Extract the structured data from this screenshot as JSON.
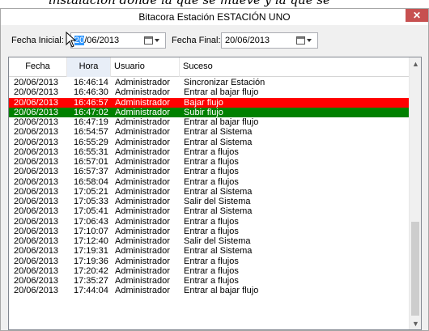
{
  "background_text": "instalación donde la que se mueve y la que se",
  "window": {
    "title": "Bitacora Estación ESTACIÓN UNO",
    "close_glyph": "✕"
  },
  "filters": {
    "start_label": "Fecha Inicial:",
    "start_value_selected": "20",
    "start_value_rest": "/06/2013",
    "end_label": "Fecha Final:",
    "end_value": "20/06/2013"
  },
  "grid": {
    "columns": [
      "Fecha",
      "Hora",
      "Usuario",
      "Suceso"
    ],
    "rows": [
      {
        "fecha": "20/06/2013",
        "hora": "16:46:14",
        "usuario": "Administrador",
        "suceso": "Sincronizar Estación",
        "highlight": ""
      },
      {
        "fecha": "20/06/2013",
        "hora": "16:46:30",
        "usuario": "Administrador",
        "suceso": "Entrar al bajar flujo",
        "highlight": ""
      },
      {
        "fecha": "20/06/2013",
        "hora": "16:46:57",
        "usuario": "Administrador",
        "suceso": "Bajar flujo",
        "highlight": "red"
      },
      {
        "fecha": "20/06/2013",
        "hora": "16:47:02",
        "usuario": "Administrador",
        "suceso": "Subir flujo",
        "highlight": "green"
      },
      {
        "fecha": "20/06/2013",
        "hora": "16:47:19",
        "usuario": "Administrador",
        "suceso": "Entrar al bajar flujo",
        "highlight": ""
      },
      {
        "fecha": "20/06/2013",
        "hora": "16:54:57",
        "usuario": "Administrador",
        "suceso": "Entrar al Sistema",
        "highlight": ""
      },
      {
        "fecha": "20/06/2013",
        "hora": "16:55:29",
        "usuario": "Administrador",
        "suceso": "Entrar al Sistema",
        "highlight": ""
      },
      {
        "fecha": "20/06/2013",
        "hora": "16:55:31",
        "usuario": "Administrador",
        "suceso": "Entrar a flujos",
        "highlight": ""
      },
      {
        "fecha": "20/06/2013",
        "hora": "16:57:01",
        "usuario": "Administrador",
        "suceso": "Entrar a flujos",
        "highlight": ""
      },
      {
        "fecha": "20/06/2013",
        "hora": "16:57:37",
        "usuario": "Administrador",
        "suceso": "Entrar a flujos",
        "highlight": ""
      },
      {
        "fecha": "20/06/2013",
        "hora": "16:58:04",
        "usuario": "Administrador",
        "suceso": "Entrar a flujos",
        "highlight": ""
      },
      {
        "fecha": "20/06/2013",
        "hora": "17:05:21",
        "usuario": "Administrador",
        "suceso": "Entrar al Sistema",
        "highlight": ""
      },
      {
        "fecha": "20/06/2013",
        "hora": "17:05:33",
        "usuario": "Administrador",
        "suceso": "Salir del Sistema",
        "highlight": ""
      },
      {
        "fecha": "20/06/2013",
        "hora": "17:05:41",
        "usuario": "Administrador",
        "suceso": "Entrar al Sistema",
        "highlight": ""
      },
      {
        "fecha": "20/06/2013",
        "hora": "17:06:43",
        "usuario": "Administrador",
        "suceso": "Entrar a flujos",
        "highlight": ""
      },
      {
        "fecha": "20/06/2013",
        "hora": "17:10:07",
        "usuario": "Administrador",
        "suceso": "Entrar a flujos",
        "highlight": ""
      },
      {
        "fecha": "20/06/2013",
        "hora": "17:12:40",
        "usuario": "Administrador",
        "suceso": "Salir del Sistema",
        "highlight": ""
      },
      {
        "fecha": "20/06/2013",
        "hora": "17:19:31",
        "usuario": "Administrador",
        "suceso": "Entrar al Sistema",
        "highlight": ""
      },
      {
        "fecha": "20/06/2013",
        "hora": "17:19:36",
        "usuario": "Administrador",
        "suceso": "Entrar a flujos",
        "highlight": ""
      },
      {
        "fecha": "20/06/2013",
        "hora": "17:20:42",
        "usuario": "Administrador",
        "suceso": "Entrar a flujos",
        "highlight": ""
      },
      {
        "fecha": "20/06/2013",
        "hora": "17:35:27",
        "usuario": "Administrador",
        "suceso": "Entrar a flujos",
        "highlight": ""
      },
      {
        "fecha": "20/06/2013",
        "hora": "17:44:04",
        "usuario": "Administrador",
        "suceso": "Entrar al bajar flujo",
        "highlight": ""
      }
    ],
    "scroll_up_glyph": "▲",
    "scroll_down_glyph": "▼"
  },
  "colors": {
    "red_row": "#ff0000",
    "green_row": "#008000",
    "close_button": "#c75050",
    "selection": "#3399ff"
  },
  "icons": {
    "calendar": "calendar-icon",
    "dropdown": "chevron-down-icon",
    "close": "close-icon",
    "cursor": "mouse-cursor-icon"
  }
}
